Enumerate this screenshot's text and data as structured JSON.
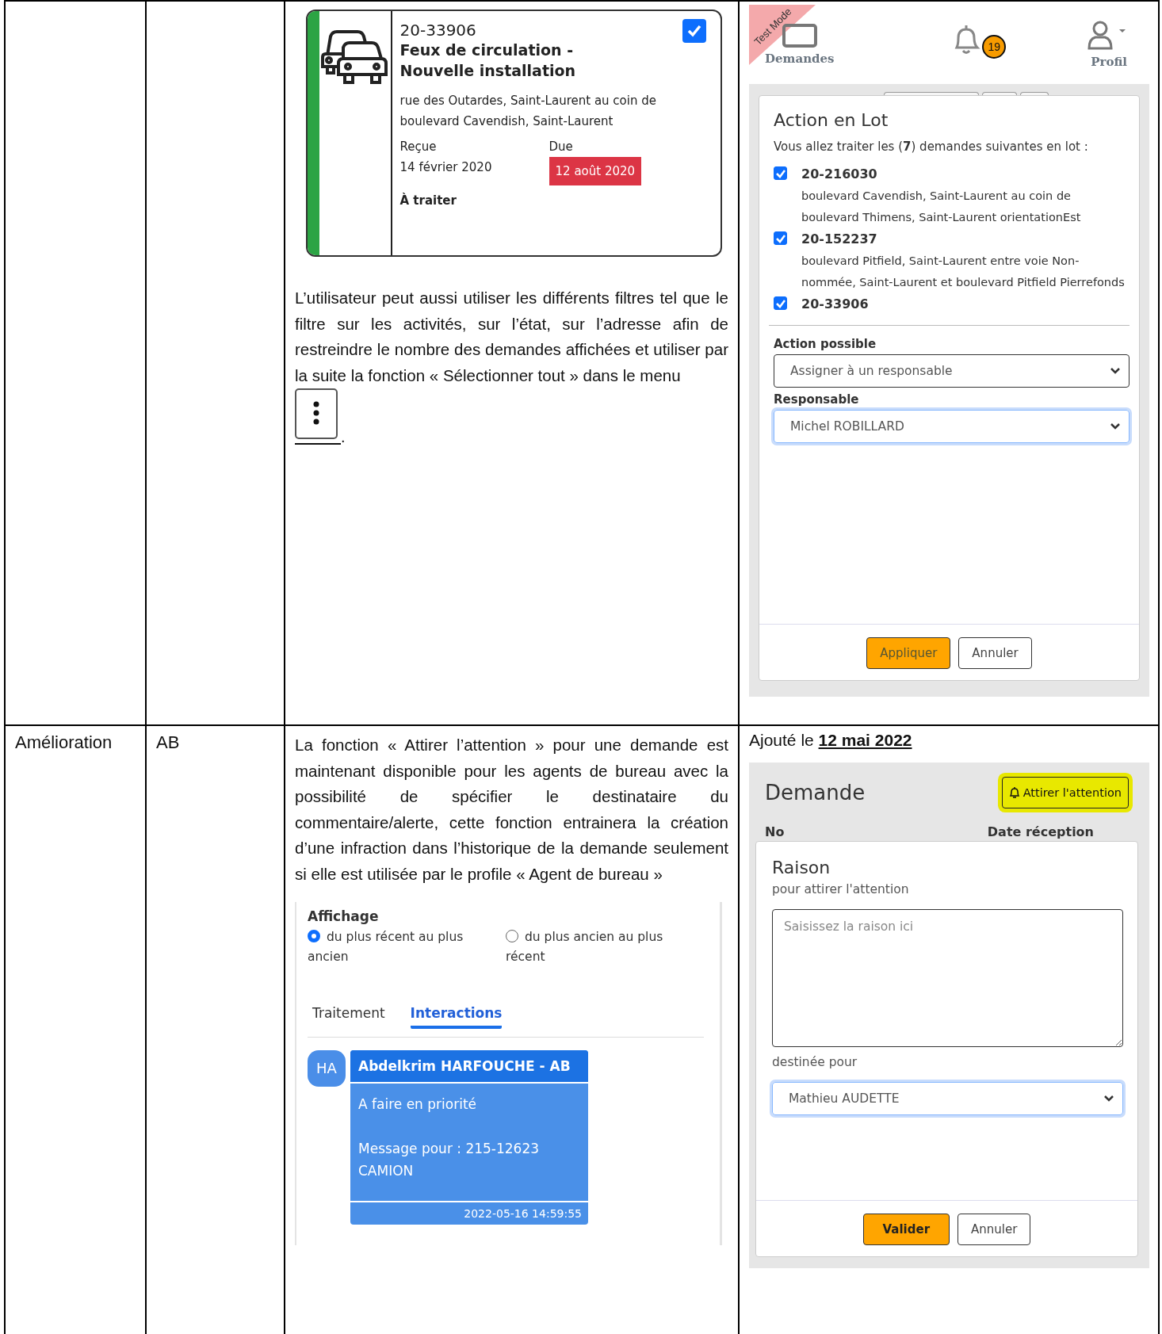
{
  "first_row": {
    "request_card": {
      "number": "20-33906",
      "title": "Feux de circulation - Nouvelle installation",
      "address": "rue des Outardes, Saint-Laurent au coin de boulevard Cavendish, Saint-Laurent",
      "received_label": "Reçue",
      "received": "14 février 2020",
      "due_label": "Due",
      "due": "12 août 2020",
      "status": "À traiter",
      "checked": true,
      "color": "#2ca444"
    },
    "paragraph": "L’utilisateur peut aussi utiliser les différents filtres tel que le filtre sur les activités, sur l’état, sur l’adresse afin de restreindre le nombre des demandes affichées et utiliser par la suite la fonction « Sélectionner tout » dans le menu",
    "end_mark": ".",
    "batch_panel": {
      "test_ribbon": "Test Mode",
      "nav_requests": "Demandes",
      "notification_count": "19",
      "nav_profile": "Profil",
      "title": "Action en Lot",
      "intro": "Vous allez traiter les (**7**) demandes suivantes en lot :",
      "items": [
        {
          "number": "20-216030",
          "address": "boulevard Cavendish, Saint-Laurent au coin de boulevard Thimens, Saint-Laurent orientationEst",
          "checked": true
        },
        {
          "number": "20-152237",
          "address": "boulevard Pitfield, Saint-Laurent entre voie Non-nommée, Saint-Laurent et boulevard Pitfield Pierrefonds",
          "checked": true
        },
        {
          "number": "20-33906",
          "checked": true
        }
      ],
      "action_label": "Action possible",
      "action_value": "Assigner à un responsable",
      "responsible_label": "Responsable",
      "responsible_value": "Michel ROBILLARD",
      "apply_button": "Appliquer",
      "cancel_button": "Annuler"
    }
  },
  "second_row": {
    "column_1": "Amélioration",
    "column_2": "AB",
    "paragraph": "La fonction « Attirer l’attention » pour une demande est maintenant disponible pour les agents de bureau avec la possibilité de spécifier le destinataire du commentaire/alerte, cette fonction entrainera la création d’une infraction dans l’historique de la demande seulement si elle est utilisée par le profile « Agent de bureau »",
    "display_panel": {
      "label": "Affichage",
      "options": [
        {
          "label": "du plus récent au plus ancien",
          "selected": true
        },
        {
          "label": "du plus ancien au plus récent",
          "selected": false
        }
      ],
      "tabs": [
        {
          "label": "Traitement",
          "selected": false
        },
        {
          "label": "Interactions",
          "selected": true
        }
      ],
      "message": {
        "initials": "HA",
        "author": "Abdelkrim HARFOUCHE - AB",
        "paragraphs": [
          [
            "A faire en priorité"
          ],
          [
            "Message pour : 215-12623",
            "CAMION"
          ]
        ],
        "timestamp": "2022-05-16 14:59:55"
      }
    },
    "added_prefix": "Ajouté le",
    "added_date": "12 mai 2022",
    "attention_panel": {
      "title": "Demande",
      "attention_button": "Attirer l'attention",
      "highlighted": true,
      "columns": [
        "No",
        "Date réception"
      ],
      "modal_title": "Raison",
      "modal_subtitle": "pour attirer l'attention",
      "reason_placeholder": "Saisissez la raison ici",
      "recipient_label": "destinée pour",
      "recipient_value": "Mathieu AUDETTE",
      "validate_button": "Valider",
      "cancel_button": "Annuler"
    }
  }
}
